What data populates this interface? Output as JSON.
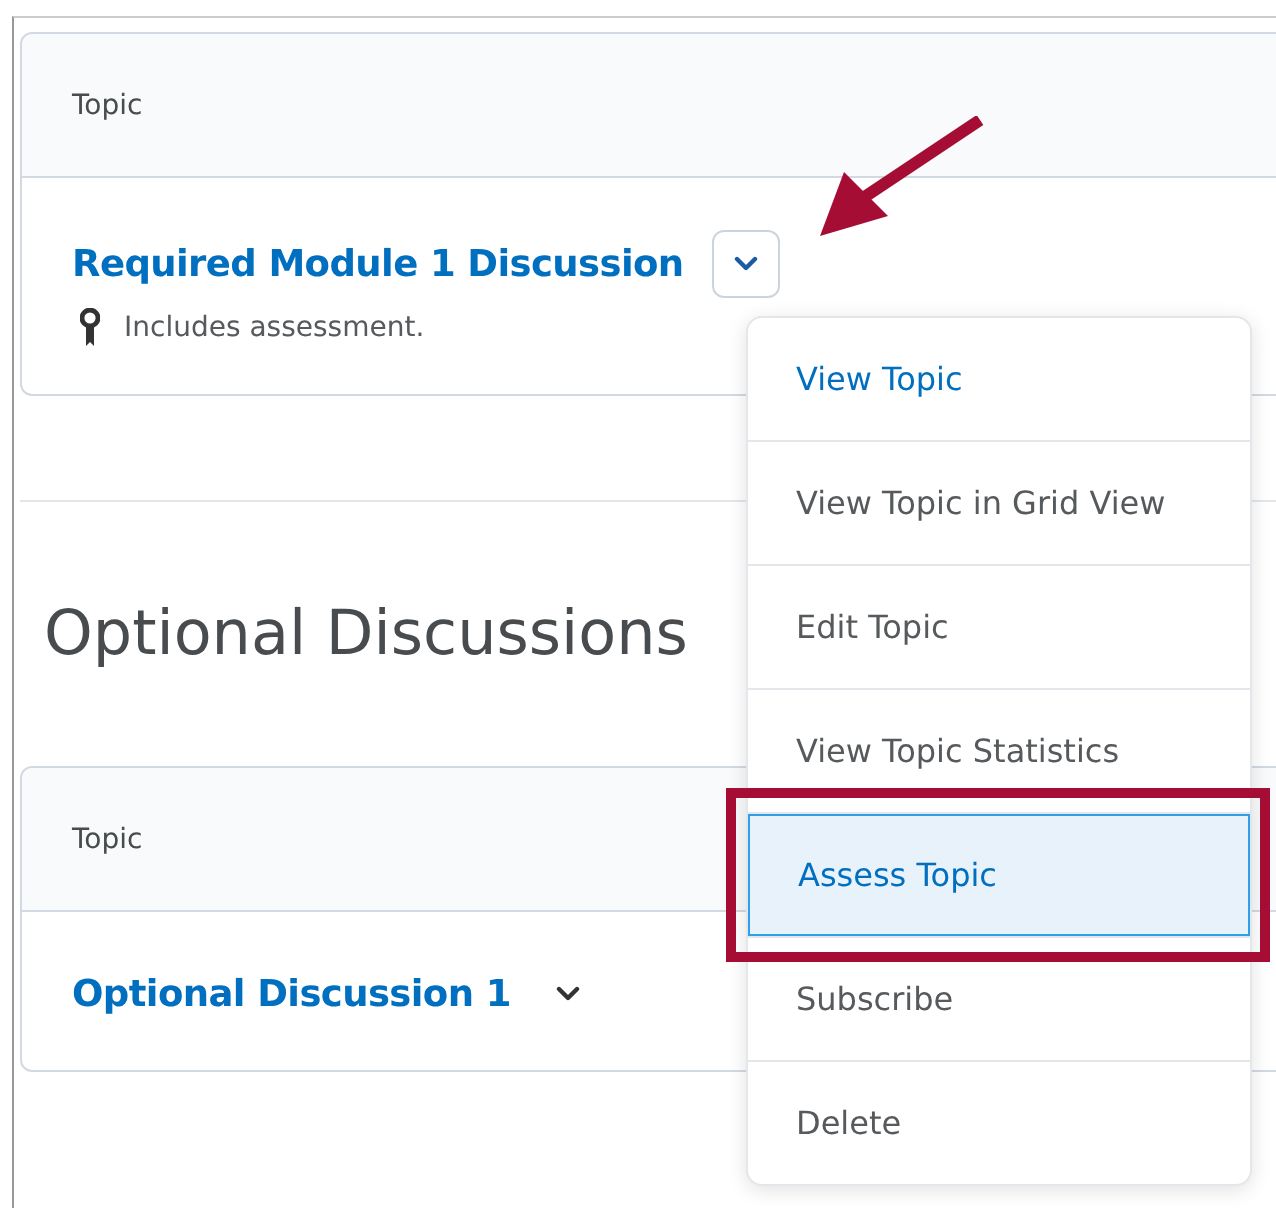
{
  "tables": [
    {
      "column": "Topic",
      "rows": [
        {
          "title": "Required Module 1 Discussion",
          "kind": "boxed",
          "note": "Includes assessment."
        }
      ]
    },
    {
      "heading": "Optional Discussions",
      "column": "Topic",
      "rows": [
        {
          "title": "Optional Discussion 1",
          "kind": "plain"
        }
      ]
    }
  ],
  "menu": {
    "items": [
      {
        "label": "View Topic",
        "selected": false
      },
      {
        "label": "View Topic in Grid View",
        "selected": false
      },
      {
        "label": "Edit Topic",
        "selected": false
      },
      {
        "label": "View Topic Statistics",
        "selected": false
      },
      {
        "label": "Assess Topic",
        "selected": true
      },
      {
        "label": "Subscribe",
        "selected": false
      },
      {
        "label": "Delete",
        "selected": false
      }
    ]
  },
  "annotations": {
    "arrow": true,
    "highlight_selected": true
  }
}
